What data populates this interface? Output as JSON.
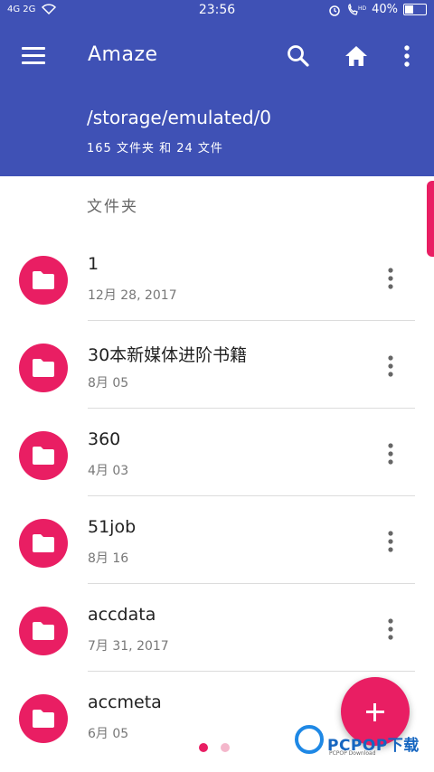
{
  "status_bar": {
    "signal_left": "4G 2G",
    "time": "23:56",
    "battery": "40%"
  },
  "app_bar": {
    "title": "Amaze"
  },
  "location": {
    "path": "/storage/emulated/0",
    "summary": "165 文件夹 和 24 文件"
  },
  "section": {
    "title": "文件夹"
  },
  "folders": [
    {
      "name": "1",
      "date": "12月 28, 2017"
    },
    {
      "name": "30本新媒体进阶书籍",
      "date": "8月 05"
    },
    {
      "name": "360",
      "date": "4月 03"
    },
    {
      "name": "51job",
      "date": "8月 16"
    },
    {
      "name": "accdata",
      "date": "7月 31, 2017"
    },
    {
      "name": "accmeta",
      "date": "6月 05"
    }
  ],
  "watermark": {
    "text": "PCPOP下载",
    "sub": "PCPOP Download"
  },
  "colors": {
    "primary": "#3f51b5",
    "accent": "#e91e63",
    "page_dot_inactive": "#f4b7cb"
  },
  "icons": [
    "menu-icon",
    "search-icon",
    "home-icon",
    "more-vert-icon",
    "folder-icon",
    "add-icon"
  ]
}
